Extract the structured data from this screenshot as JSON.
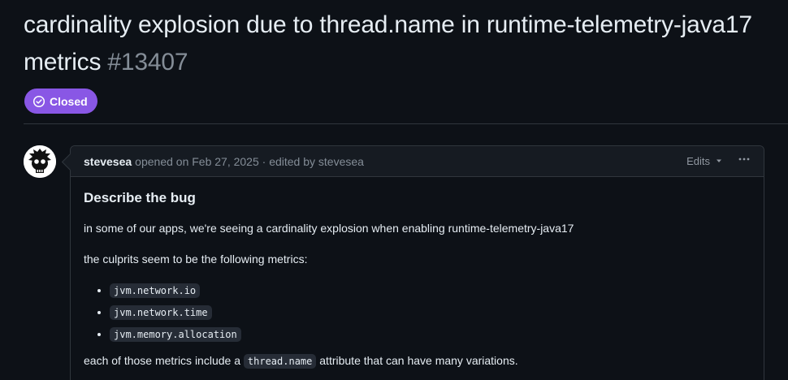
{
  "issue": {
    "title": "cardinality explosion due to thread.name in runtime-telemetry-java17 metrics",
    "number": "#13407",
    "state": "Closed",
    "state_icon": "check-circle-icon",
    "state_color": "#8957e5"
  },
  "comment": {
    "author": "stevesea",
    "meta": "opened on Feb 27, 2025 · edited by stevesea",
    "edits_label": "Edits",
    "more_icon": "kebab-horizontal-icon",
    "body": {
      "heading": "Describe the bug",
      "p1": "in some of our apps, we're seeing a cardinality explosion when enabling runtime-telemetry-java17",
      "p2": "the culprits seem to be the following metrics:",
      "metrics": [
        "jvm.network.io",
        "jvm.network.time",
        "jvm.memory.allocation"
      ],
      "p3_before": "each of those metrics include a",
      "p3_code": "thread.name",
      "p3_after": "attribute that can have many variations."
    }
  },
  "colors": {
    "background": "#0d1117",
    "border": "#30363d",
    "muted_text": "#848d97",
    "text": "#e6edf3"
  }
}
